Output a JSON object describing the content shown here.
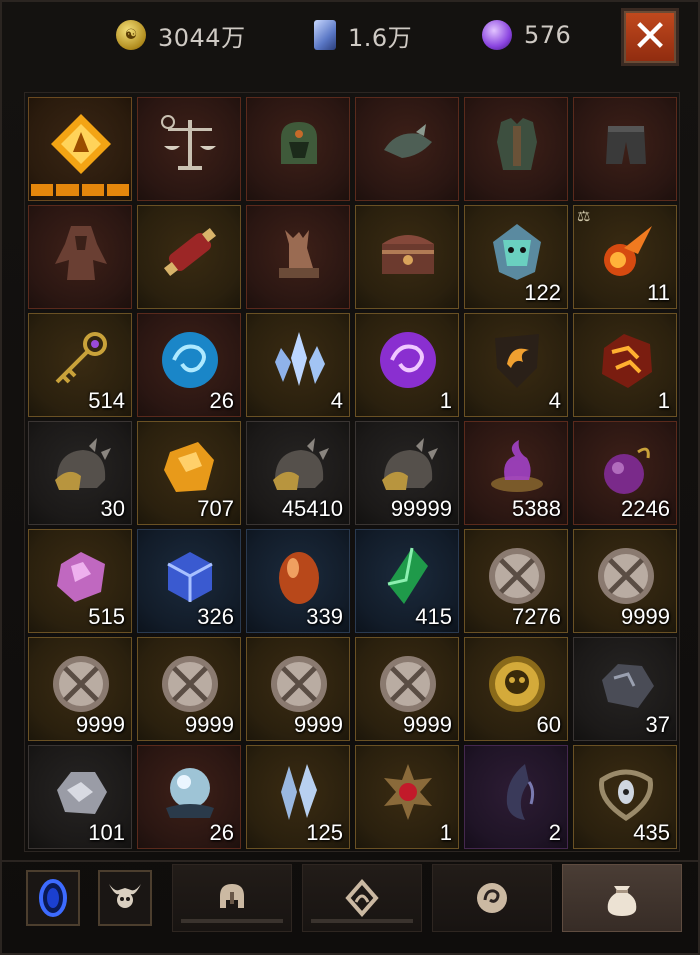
{
  "currency": {
    "gold": {
      "icon": "gold-coin-icon",
      "value": "3044万"
    },
    "card": {
      "icon": "blue-card-icon",
      "value": "1.6万"
    },
    "orb": {
      "icon": "purple-orb-icon",
      "value": "576"
    }
  },
  "close_label": "✕",
  "colors": {
    "accent": "#c24a1e",
    "level": "#e5870c",
    "quantity": "#ffffff"
  },
  "inventory": [
    {
      "icon": "legendary-glyph-icon",
      "rarity": "orange",
      "qty": "",
      "level_bars": 3
    },
    {
      "icon": "scales-icon",
      "rarity": "red",
      "qty": ""
    },
    {
      "icon": "helmet-icon",
      "rarity": "red",
      "qty": ""
    },
    {
      "icon": "shoulder-armor-icon",
      "rarity": "red",
      "qty": ""
    },
    {
      "icon": "chest-armor-icon",
      "rarity": "red",
      "qty": ""
    },
    {
      "icon": "pants-icon",
      "rarity": "red",
      "qty": ""
    },
    {
      "icon": "treant-costume-icon",
      "rarity": "red",
      "qty": ""
    },
    {
      "icon": "scroll-icon",
      "rarity": "gold",
      "qty": ""
    },
    {
      "icon": "wolf-statue-icon",
      "rarity": "red",
      "qty": ""
    },
    {
      "icon": "treasure-chest-icon",
      "rarity": "gold",
      "qty": ""
    },
    {
      "icon": "demon-mask-icon",
      "rarity": "gold",
      "qty": "122"
    },
    {
      "icon": "fire-meteor-icon",
      "rarity": "gold",
      "qty": "11",
      "marked": true
    },
    {
      "icon": "golden-key-icon",
      "rarity": "gold",
      "qty": "514"
    },
    {
      "icon": "blue-vortex-icon",
      "rarity": "red",
      "qty": "26"
    },
    {
      "icon": "ice-crystal-icon",
      "rarity": "gold",
      "qty": "4"
    },
    {
      "icon": "purple-vortex-icon",
      "rarity": "gold",
      "qty": "1"
    },
    {
      "icon": "fire-shield-icon",
      "rarity": "gold",
      "qty": "4"
    },
    {
      "icon": "magma-rock-icon",
      "rarity": "gold",
      "qty": "1"
    },
    {
      "icon": "gold-helmet-icon",
      "rarity": "grey",
      "qty": "30"
    },
    {
      "icon": "amber-ore-icon",
      "rarity": "gold",
      "qty": "707"
    },
    {
      "icon": "gold-helmet-icon",
      "rarity": "grey",
      "qty": "45410"
    },
    {
      "icon": "gold-helmet-icon",
      "rarity": "grey",
      "qty": "99999"
    },
    {
      "icon": "purple-brazier-icon",
      "rarity": "red",
      "qty": "5388"
    },
    {
      "icon": "purple-potion-icon",
      "rarity": "red",
      "qty": "2246"
    },
    {
      "icon": "pink-ore-icon",
      "rarity": "gold",
      "qty": "515"
    },
    {
      "icon": "blue-cube-icon",
      "rarity": "blue",
      "qty": "326"
    },
    {
      "icon": "dragon-egg-icon",
      "rarity": "blue",
      "qty": "339"
    },
    {
      "icon": "green-crystal-icon",
      "rarity": "blue",
      "qty": "415"
    },
    {
      "icon": "crossed-swords-medal-icon",
      "rarity": "gold",
      "qty": "7276"
    },
    {
      "icon": "crossed-swords-medal-icon",
      "rarity": "gold",
      "qty": "9999"
    },
    {
      "icon": "crossed-swords-medal-icon",
      "rarity": "gold",
      "qty": "9999"
    },
    {
      "icon": "crossed-swords-medal-icon",
      "rarity": "gold",
      "qty": "9999"
    },
    {
      "icon": "crossed-swords-medal-icon",
      "rarity": "gold",
      "qty": "9999"
    },
    {
      "icon": "crossed-swords-medal-icon",
      "rarity": "gold",
      "qty": "9999"
    },
    {
      "icon": "gold-skull-medal-icon",
      "rarity": "gold",
      "qty": "60"
    },
    {
      "icon": "iron-ore-icon",
      "rarity": "grey",
      "qty": "37"
    },
    {
      "icon": "silver-ore-icon",
      "rarity": "grey",
      "qty": "101"
    },
    {
      "icon": "pearl-orb-icon",
      "rarity": "red",
      "qty": "26"
    },
    {
      "icon": "blue-shards-icon",
      "rarity": "gold",
      "qty": "125"
    },
    {
      "icon": "red-gem-amulet-icon",
      "rarity": "gold",
      "qty": "1"
    },
    {
      "icon": "dark-claw-icon",
      "rarity": "purple",
      "qty": "2"
    },
    {
      "icon": "eye-rune-icon",
      "rarity": "gold",
      "qty": "435"
    }
  ],
  "filters": [
    {
      "icon": "blue-portal-icon"
    },
    {
      "icon": "horned-skull-icon"
    }
  ],
  "tabs": [
    {
      "icon": "helmet-tab-icon",
      "active": false
    },
    {
      "icon": "rune-tab-icon",
      "active": false
    },
    {
      "icon": "swirl-tab-icon",
      "active": false
    },
    {
      "icon": "bag-tab-icon",
      "active": true
    }
  ]
}
